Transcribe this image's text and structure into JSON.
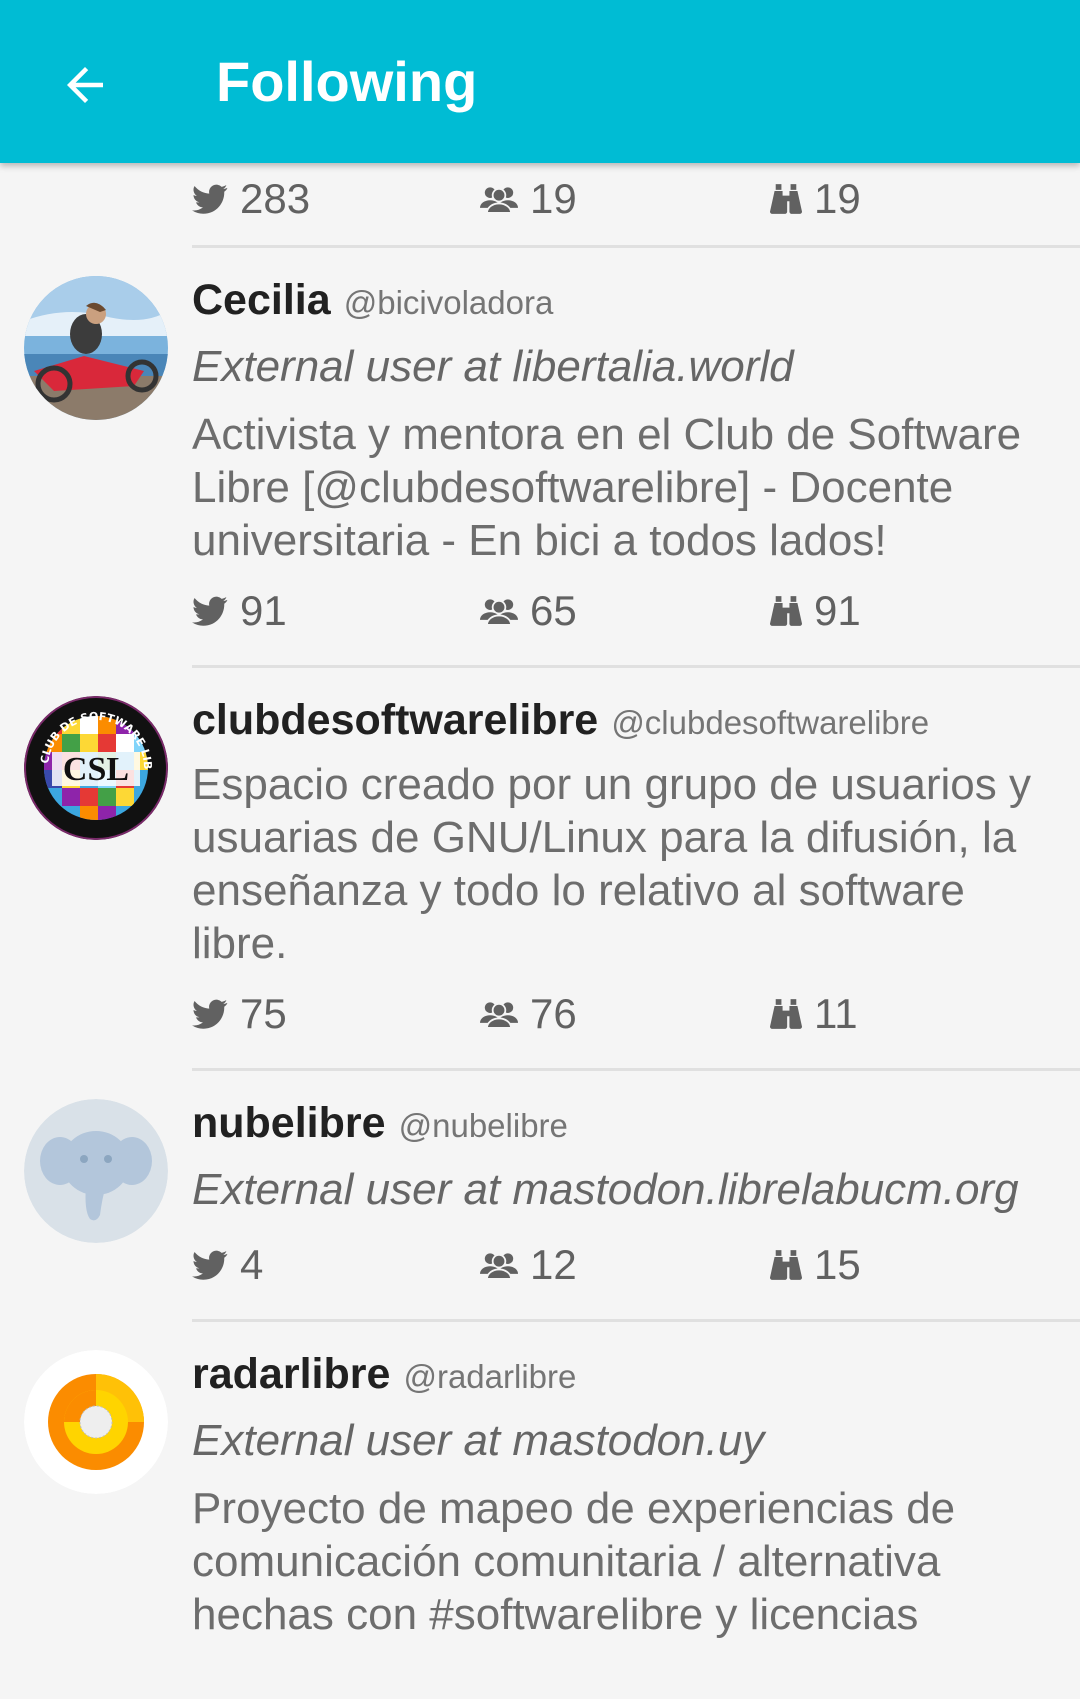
{
  "appbar": {
    "title": "Following",
    "bg_color": "#00bcd4"
  },
  "top_partial": {
    "posts": "283",
    "following": "19",
    "followers": "19"
  },
  "users": [
    {
      "name": "Cecilia",
      "handle": "@bicivoladora",
      "external": "External user at libertalia.world",
      "bio": "Activista y mentora en el Club de Software Libre [@clubdesoftwarelibre] - Docente universitaria - En bici a todos lados!",
      "posts": "91",
      "following": "65",
      "followers": "91"
    },
    {
      "name": "clubdesoftwarelibre",
      "handle": "@clubdesoftwarelibre",
      "avatar_text": "CSL",
      "avatar_ring_text": "CLUB DE SOFTWARE LIBRE",
      "bio": "Espacio creado por un grupo de usuarios y usuarias de GNU/Linux para la difusión, la enseñanza y todo lo relativo al software libre.",
      "posts": "75",
      "following": "76",
      "followers": "11"
    },
    {
      "name": "nubelibre",
      "handle": "@nubelibre",
      "external": "External user at mastodon.librelabucm.org",
      "posts": "4",
      "following": "12",
      "followers": "15"
    },
    {
      "name": "radarlibre",
      "handle": "@radarlibre",
      "external": "External user at mastodon.uy",
      "bio": "Proyecto de mapeo de experiencias de comunicación comunitaria / alternativa hechas con #softwarelibre y licencias"
    }
  ],
  "icons": {
    "back": "arrow-left-icon",
    "posts": "twitter-bird-icon",
    "following": "users-group-icon",
    "followers": "binoculars-icon"
  }
}
